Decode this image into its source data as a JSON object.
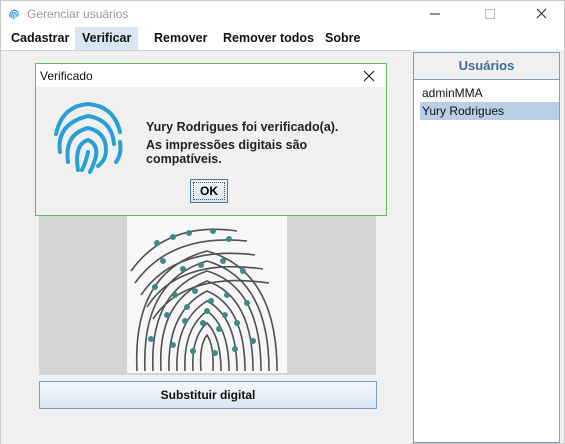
{
  "window": {
    "title": "Gerenciar usuários"
  },
  "menu": {
    "items": [
      {
        "label": "Cadastrar"
      },
      {
        "label": "Verificar"
      },
      {
        "label": "Remover"
      },
      {
        "label": "Remover todos"
      },
      {
        "label": "Sobre"
      }
    ],
    "active_index": 1
  },
  "main": {
    "replace_button": "Substituir digital"
  },
  "users": {
    "header": "Usuários",
    "list": [
      "adminMMA",
      "Yury Rodrigues"
    ],
    "selected_index": 1
  },
  "dialog": {
    "title": "Verificado",
    "line1": "Yury Rodrigues foi verificado(a).",
    "line2": "As impressões digitais são compatíveis.",
    "ok": "OK"
  },
  "colors": {
    "accent_blue": "#3e6aa0",
    "fingerprint_icon": "#2a9fd6",
    "minutiae": "#3f8a85",
    "dialog_border": "#5cbf5c"
  },
  "icons": [
    "fingerprint-icon",
    "minimize-icon",
    "maximize-icon",
    "close-icon"
  ]
}
